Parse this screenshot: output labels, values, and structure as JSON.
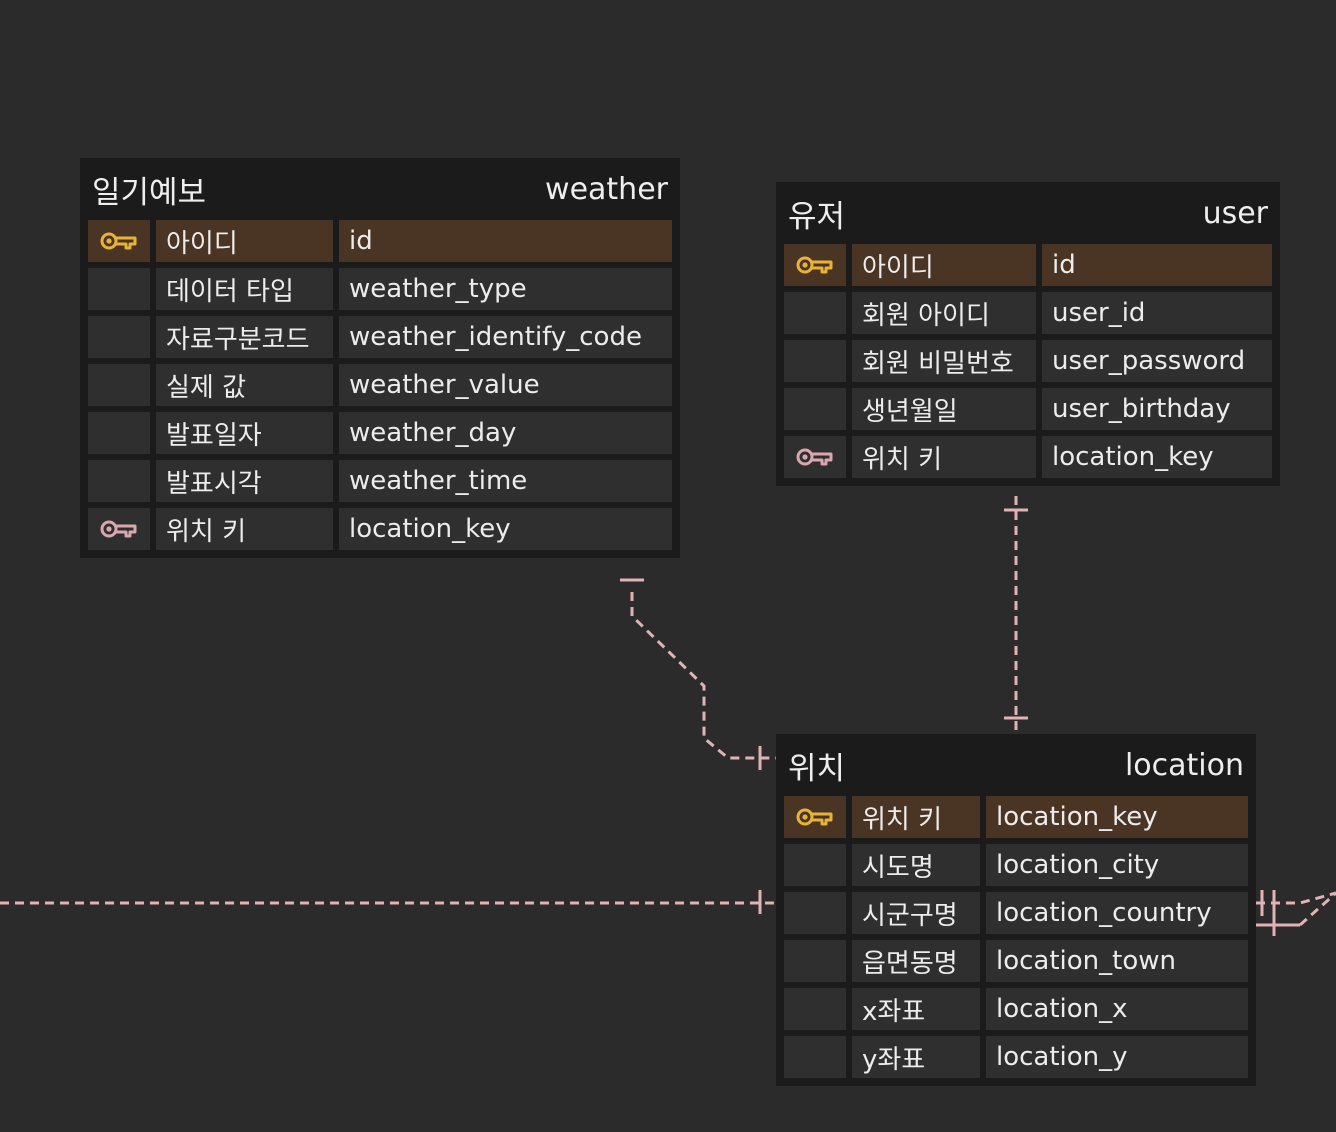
{
  "colors": {
    "background": "#2b2b2b",
    "table": "#1b1b1b",
    "row": "#2f2f2f",
    "primary_row": "#4a3424",
    "relation_line": "#e2b2b7",
    "primary_key_icon": "#e8b437",
    "foreign_key_icon": "#d9a7ad"
  },
  "icons": {
    "primary_key": "key-icon",
    "foreign_key": "key-icon"
  },
  "tables": {
    "weather": {
      "title_kr": "일기예보",
      "title_en": "weather",
      "columns": [
        {
          "kr": "아이디",
          "en": "id",
          "key": "primary"
        },
        {
          "kr": "데이터 타입",
          "en": "weather_type",
          "key": ""
        },
        {
          "kr": "자료구분코드",
          "en": "weather_identify_code",
          "key": ""
        },
        {
          "kr": "실제 값",
          "en": "weather_value",
          "key": ""
        },
        {
          "kr": "발표일자",
          "en": "weather_day",
          "key": ""
        },
        {
          "kr": "발표시각",
          "en": "weather_time",
          "key": ""
        },
        {
          "kr": "위치 키",
          "en": "location_key",
          "key": "foreign"
        }
      ]
    },
    "user": {
      "title_kr": "유저",
      "title_en": "user",
      "columns": [
        {
          "kr": "아이디",
          "en": "id",
          "key": "primary"
        },
        {
          "kr": "회원 아이디",
          "en": "user_id",
          "key": ""
        },
        {
          "kr": "회원 비밀번호",
          "en": "user_password",
          "key": ""
        },
        {
          "kr": "생년월일",
          "en": "user_birthday",
          "key": ""
        },
        {
          "kr": "위치 키",
          "en": "location_key",
          "key": "foreign"
        }
      ]
    },
    "location": {
      "title_kr": "위치",
      "title_en": "location",
      "columns": [
        {
          "kr": "위치 키",
          "en": "location_key",
          "key": "primary"
        },
        {
          "kr": "시도명",
          "en": "location_city",
          "key": ""
        },
        {
          "kr": "시군구명",
          "en": "location_country",
          "key": ""
        },
        {
          "kr": "읍면동명",
          "en": "location_town",
          "key": ""
        },
        {
          "kr": "x좌표",
          "en": "location_x",
          "key": ""
        },
        {
          "kr": "y좌표",
          "en": "location_y",
          "key": ""
        }
      ]
    }
  }
}
